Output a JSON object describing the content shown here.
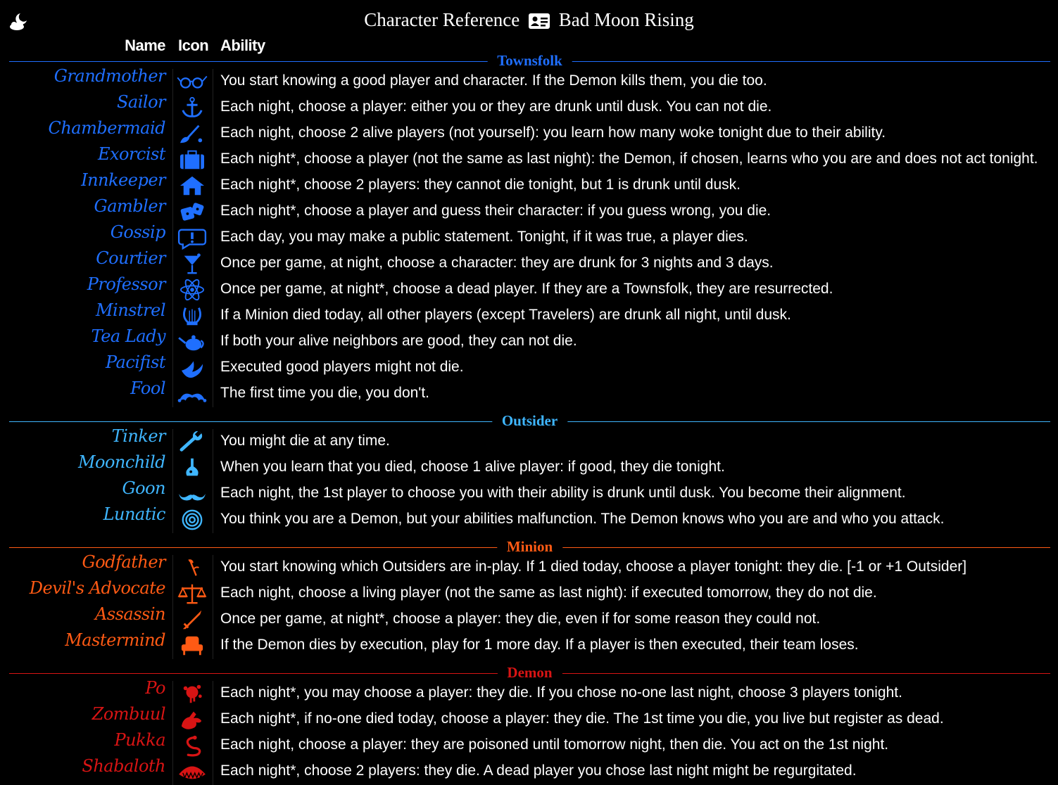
{
  "header": {
    "title_left": "Character Reference",
    "title_right": "Bad Moon Rising",
    "card_icon": "id-card-icon",
    "corner_icon": "moon-cloud-icon",
    "col_name": "Name",
    "col_icon": "Icon",
    "col_ability": "Ability"
  },
  "colors": {
    "townsfolk": "#1f6fff",
    "outsider": "#3fb6ff",
    "minion": "#ff5a14",
    "demon": "#d81414"
  },
  "sections": [
    {
      "key": "townsfolk",
      "label": "Townsfolk",
      "characters": [
        {
          "name": "Grandmother",
          "icon": "spectacles-icon",
          "ability": "You start knowing a good player and character. If the Demon kills them, you die too."
        },
        {
          "name": "Sailor",
          "icon": "anchor-icon",
          "ability": "Each night, choose a player: either you or they are drunk until dusk. You can not die."
        },
        {
          "name": "Chambermaid",
          "icon": "feather-duster-icon",
          "ability": "Each night, choose 2 alive players (not yourself): you learn how many woke tonight due to their ability."
        },
        {
          "name": "Exorcist",
          "icon": "suitcase-icon",
          "ability": "Each night*, choose a player (not the same as last night): the Demon, if chosen, learns who you are and does not act tonight."
        },
        {
          "name": "Innkeeper",
          "icon": "house-icon",
          "ability": "Each night*, choose 2 players: they cannot die tonight, but 1 is drunk until dusk."
        },
        {
          "name": "Gambler",
          "icon": "dice-icon",
          "ability": "Each night*, choose a player and guess their character: if you guess wrong, you die."
        },
        {
          "name": "Gossip",
          "icon": "speech-bubble-icon",
          "ability": "Each day, you may make a public statement. Tonight, if it was true, a player dies."
        },
        {
          "name": "Courtier",
          "icon": "cocktail-glass-icon",
          "ability": "Once per game, at night, choose a character: they are drunk for 3 nights and 3 days."
        },
        {
          "name": "Professor",
          "icon": "atom-icon",
          "ability": "Once per game, at night*, choose a dead player. If they are a Townsfolk, they are resurrected."
        },
        {
          "name": "Minstrel",
          "icon": "lyre-icon",
          "ability": "If a Minion died today, all other players (except Travelers) are drunk all night, until dusk."
        },
        {
          "name": "Tea Lady",
          "icon": "teapot-icon",
          "ability": "If both your alive neighbors are good, they can not die."
        },
        {
          "name": "Pacifist",
          "icon": "dove-icon",
          "ability": "Executed good players might not die."
        },
        {
          "name": "Fool",
          "icon": "jester-hat-icon",
          "ability": "The first time you die, you don't."
        }
      ]
    },
    {
      "key": "outsider",
      "label": "Outsider",
      "characters": [
        {
          "name": "Tinker",
          "icon": "wrench-icon",
          "ability": "You might die at any time."
        },
        {
          "name": "Moonchild",
          "icon": "flask-icon",
          "ability": "When you learn that you died, choose 1 alive player: if good, they die tonight."
        },
        {
          "name": "Goon",
          "icon": "mustache-icon",
          "ability": "Each night, the 1st player to choose you with their ability is drunk until dusk. You become their alignment."
        },
        {
          "name": "Lunatic",
          "icon": "spiral-icon",
          "ability": "You think you are a Demon, but your abilities malfunction. The Demon knows who you are and who you attack."
        }
      ]
    },
    {
      "key": "minion",
      "label": "Minion",
      "characters": [
        {
          "name": "Godfather",
          "icon": "rose-icon",
          "ability": "You start knowing which Outsiders are in-play. If 1 died today, choose a player tonight: they die. [-1 or +1 Outsider]"
        },
        {
          "name": "Devil's Advocate",
          "icon": "scales-icon",
          "ability": "Each night, choose a living player (not the same as last night): if executed tomorrow, they do not die."
        },
        {
          "name": "Assassin",
          "icon": "dagger-icon",
          "ability": "Once per game, at night*, choose a player: they die, even if for some reason they could not."
        },
        {
          "name": "Mastermind",
          "icon": "armchair-icon",
          "ability": "If the Demon dies by execution, play for 1 more day. If a player is then executed, their team loses."
        }
      ]
    },
    {
      "key": "demon",
      "label": "Demon",
      "characters": [
        {
          "name": "Po",
          "icon": "blood-splat-icon",
          "ability": "Each night*, you may choose a player: they die. If you chose no-one last night, choose 3 players tonight."
        },
        {
          "name": "Zombuul",
          "icon": "zombie-hand-icon",
          "ability": "Each night*, if no-one died today, choose a player: they die. The 1st time you die, you live but register as dead."
        },
        {
          "name": "Pukka",
          "icon": "snake-icon",
          "ability": "Each night, choose a player: they are poisoned until tomorrow night, then die. You act on the 1st night."
        },
        {
          "name": "Shabaloth",
          "icon": "fanged-mouth-icon",
          "ability": "Each night*, choose 2 players: they die. A dead player you chose last night might be regurgitated."
        }
      ]
    }
  ]
}
